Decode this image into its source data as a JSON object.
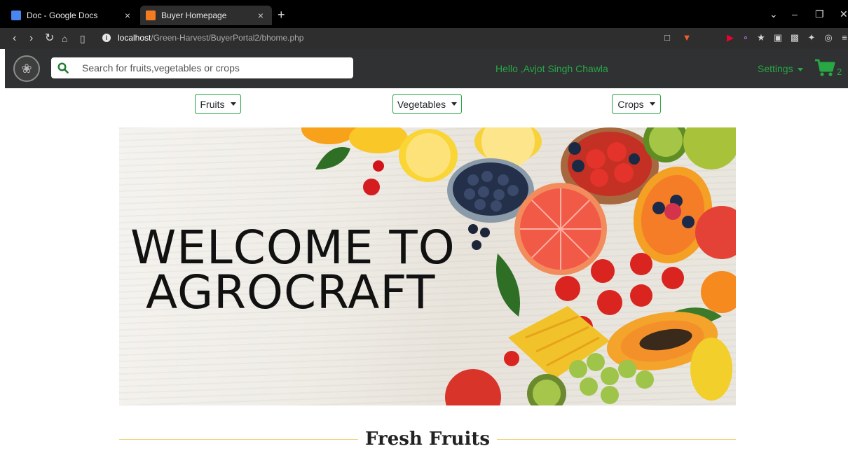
{
  "browser": {
    "tabs": [
      {
        "title": "Doc - Google Docs",
        "icon": "google-docs-icon",
        "active": false
      },
      {
        "title": "Buyer Homepage",
        "icon": "xampp-icon",
        "active": true
      }
    ],
    "new_tab": "+",
    "close": "×",
    "url_host": "localhost",
    "url_path": "/Green-Harvest/BuyerPortal2/bhome.php"
  },
  "nav": {
    "search_placeholder": "Search for fruits,vegetables or crops",
    "greeting": "Hello ,Avjot Singh Chawla",
    "settings_label": "Settings",
    "cart_count": "2"
  },
  "categories": [
    {
      "label": "Fruits"
    },
    {
      "label": "Vegetables"
    },
    {
      "label": "Crops"
    }
  ],
  "hero": {
    "line1": "WELCOME TO",
    "line2": "AGROCRAFT"
  },
  "section": {
    "title": "Fresh Fruits"
  },
  "colors": {
    "accent": "#28a745",
    "navbar": "#2f3133",
    "divider": "#f2d27a"
  }
}
